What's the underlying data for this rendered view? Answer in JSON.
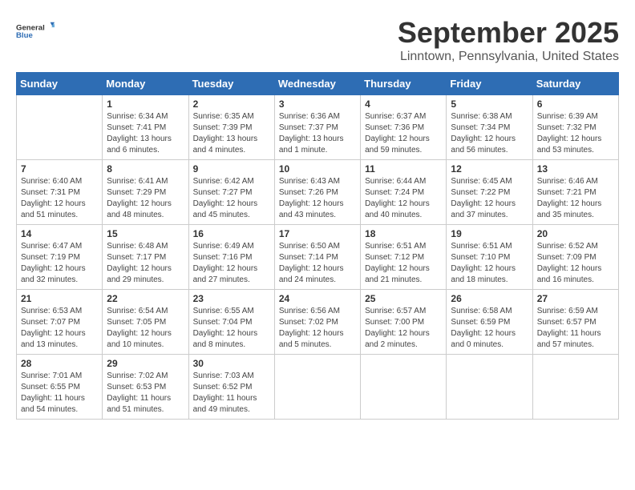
{
  "logo": {
    "general": "General",
    "blue": "Blue"
  },
  "title": "September 2025",
  "subtitle": "Linntown, Pennsylvania, United States",
  "headers": [
    "Sunday",
    "Monday",
    "Tuesday",
    "Wednesday",
    "Thursday",
    "Friday",
    "Saturday"
  ],
  "weeks": [
    [
      {
        "day": "",
        "info": ""
      },
      {
        "day": "1",
        "info": "Sunrise: 6:34 AM\nSunset: 7:41 PM\nDaylight: 13 hours\nand 6 minutes."
      },
      {
        "day": "2",
        "info": "Sunrise: 6:35 AM\nSunset: 7:39 PM\nDaylight: 13 hours\nand 4 minutes."
      },
      {
        "day": "3",
        "info": "Sunrise: 6:36 AM\nSunset: 7:37 PM\nDaylight: 13 hours\nand 1 minute."
      },
      {
        "day": "4",
        "info": "Sunrise: 6:37 AM\nSunset: 7:36 PM\nDaylight: 12 hours\nand 59 minutes."
      },
      {
        "day": "5",
        "info": "Sunrise: 6:38 AM\nSunset: 7:34 PM\nDaylight: 12 hours\nand 56 minutes."
      },
      {
        "day": "6",
        "info": "Sunrise: 6:39 AM\nSunset: 7:32 PM\nDaylight: 12 hours\nand 53 minutes."
      }
    ],
    [
      {
        "day": "7",
        "info": "Sunrise: 6:40 AM\nSunset: 7:31 PM\nDaylight: 12 hours\nand 51 minutes."
      },
      {
        "day": "8",
        "info": "Sunrise: 6:41 AM\nSunset: 7:29 PM\nDaylight: 12 hours\nand 48 minutes."
      },
      {
        "day": "9",
        "info": "Sunrise: 6:42 AM\nSunset: 7:27 PM\nDaylight: 12 hours\nand 45 minutes."
      },
      {
        "day": "10",
        "info": "Sunrise: 6:43 AM\nSunset: 7:26 PM\nDaylight: 12 hours\nand 43 minutes."
      },
      {
        "day": "11",
        "info": "Sunrise: 6:44 AM\nSunset: 7:24 PM\nDaylight: 12 hours\nand 40 minutes."
      },
      {
        "day": "12",
        "info": "Sunrise: 6:45 AM\nSunset: 7:22 PM\nDaylight: 12 hours\nand 37 minutes."
      },
      {
        "day": "13",
        "info": "Sunrise: 6:46 AM\nSunset: 7:21 PM\nDaylight: 12 hours\nand 35 minutes."
      }
    ],
    [
      {
        "day": "14",
        "info": "Sunrise: 6:47 AM\nSunset: 7:19 PM\nDaylight: 12 hours\nand 32 minutes."
      },
      {
        "day": "15",
        "info": "Sunrise: 6:48 AM\nSunset: 7:17 PM\nDaylight: 12 hours\nand 29 minutes."
      },
      {
        "day": "16",
        "info": "Sunrise: 6:49 AM\nSunset: 7:16 PM\nDaylight: 12 hours\nand 27 minutes."
      },
      {
        "day": "17",
        "info": "Sunrise: 6:50 AM\nSunset: 7:14 PM\nDaylight: 12 hours\nand 24 minutes."
      },
      {
        "day": "18",
        "info": "Sunrise: 6:51 AM\nSunset: 7:12 PM\nDaylight: 12 hours\nand 21 minutes."
      },
      {
        "day": "19",
        "info": "Sunrise: 6:51 AM\nSunset: 7:10 PM\nDaylight: 12 hours\nand 18 minutes."
      },
      {
        "day": "20",
        "info": "Sunrise: 6:52 AM\nSunset: 7:09 PM\nDaylight: 12 hours\nand 16 minutes."
      }
    ],
    [
      {
        "day": "21",
        "info": "Sunrise: 6:53 AM\nSunset: 7:07 PM\nDaylight: 12 hours\nand 13 minutes."
      },
      {
        "day": "22",
        "info": "Sunrise: 6:54 AM\nSunset: 7:05 PM\nDaylight: 12 hours\nand 10 minutes."
      },
      {
        "day": "23",
        "info": "Sunrise: 6:55 AM\nSunset: 7:04 PM\nDaylight: 12 hours\nand 8 minutes."
      },
      {
        "day": "24",
        "info": "Sunrise: 6:56 AM\nSunset: 7:02 PM\nDaylight: 12 hours\nand 5 minutes."
      },
      {
        "day": "25",
        "info": "Sunrise: 6:57 AM\nSunset: 7:00 PM\nDaylight: 12 hours\nand 2 minutes."
      },
      {
        "day": "26",
        "info": "Sunrise: 6:58 AM\nSunset: 6:59 PM\nDaylight: 12 hours\nand 0 minutes."
      },
      {
        "day": "27",
        "info": "Sunrise: 6:59 AM\nSunset: 6:57 PM\nDaylight: 11 hours\nand 57 minutes."
      }
    ],
    [
      {
        "day": "28",
        "info": "Sunrise: 7:01 AM\nSunset: 6:55 PM\nDaylight: 11 hours\nand 54 minutes."
      },
      {
        "day": "29",
        "info": "Sunrise: 7:02 AM\nSunset: 6:53 PM\nDaylight: 11 hours\nand 51 minutes."
      },
      {
        "day": "30",
        "info": "Sunrise: 7:03 AM\nSunset: 6:52 PM\nDaylight: 11 hours\nand 49 minutes."
      },
      {
        "day": "",
        "info": ""
      },
      {
        "day": "",
        "info": ""
      },
      {
        "day": "",
        "info": ""
      },
      {
        "day": "",
        "info": ""
      }
    ]
  ]
}
